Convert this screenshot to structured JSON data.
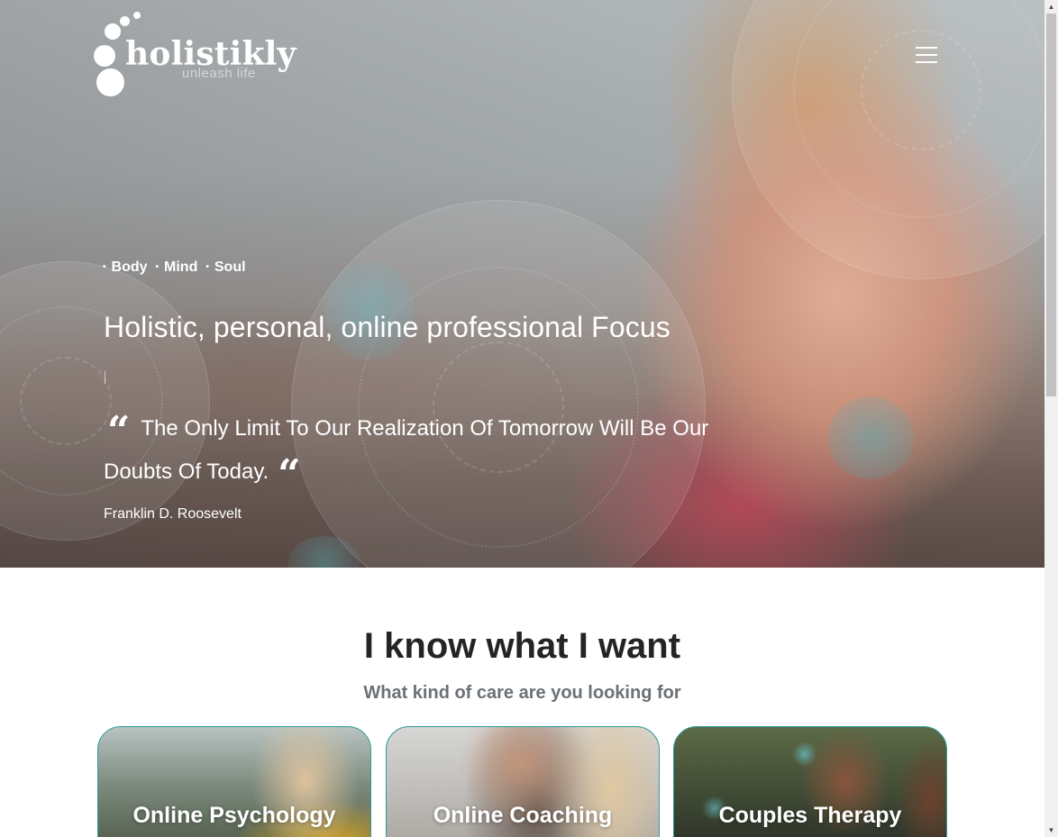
{
  "brand": {
    "name": "holistikly",
    "tagline": "unleash life"
  },
  "header": {
    "menu_icon": "hamburger-menu-icon"
  },
  "hero": {
    "pillars": [
      "Body",
      "Mind",
      "Soul"
    ],
    "headline": "Holistic, personal, online professional Focus",
    "quote_text": "The Only Limit To Our Realization Of Tomorrow Will Be Our Doubts Of Today.",
    "quote_open_glyph": "“",
    "quote_close_glyph": "“",
    "quote_author": "Franklin D. Roosevelt"
  },
  "section": {
    "title": "I know what I want",
    "subtitle": "What kind of care are you looking for"
  },
  "cards": [
    {
      "label": "Online Psychology"
    },
    {
      "label": "Online Coaching"
    },
    {
      "label": "Couples Therapy"
    }
  ],
  "colors": {
    "accent": "#2d9a96",
    "heading": "#222426",
    "subheading": "#6b7176",
    "hero_text": "#ffffff"
  },
  "scrollbar": {
    "up_icon": "scroll-up-arrow-icon",
    "down_icon": "scroll-down-arrow-icon"
  }
}
